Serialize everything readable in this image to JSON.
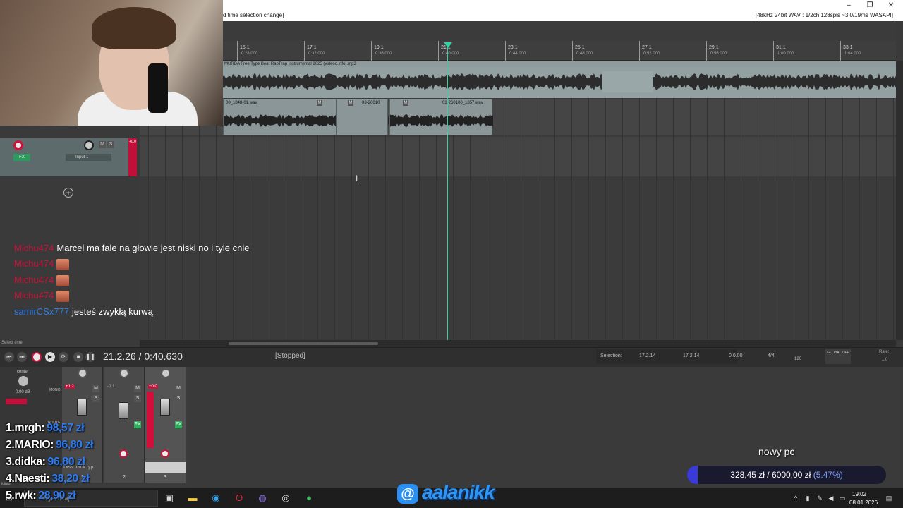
{
  "window": {
    "title_left": "d time selection change]",
    "title_right": "[48kHz 24bit WAV : 1/2ch 128spls ~3.0/19ms WASAPI]",
    "minimize": "–",
    "maximize": "❐",
    "close": "✕"
  },
  "ruler": {
    "ticks": [
      {
        "label": "15.1",
        "time": "0:28.000"
      },
      {
        "label": "17.1",
        "time": "0:32.000"
      },
      {
        "label": "19.1",
        "time": "0:36.000"
      },
      {
        "label": "21.1",
        "time": "0:40.000"
      },
      {
        "label": "23.1",
        "time": "0:44.000"
      },
      {
        "label": "25.1",
        "time": "0:48.000"
      },
      {
        "label": "27.1",
        "time": "0:52.000"
      },
      {
        "label": "29.1",
        "time": "0:56.000"
      },
      {
        "label": "31.1",
        "time": "1:00.000"
      },
      {
        "label": "33.1",
        "time": "1:04.000"
      }
    ]
  },
  "tracks": {
    "beat_item": "MURDA Free Type Beat RapTrap Instrumental 2025 (videoo.info).mp3",
    "clips": [
      {
        "name": "00_1848-01.wav"
      },
      {
        "name": "03-26010"
      },
      {
        "name": "03-260100_1857.wav"
      }
    ],
    "track_input": "Input 1",
    "meter_peak": "+0.0",
    "m_label": "M",
    "s_label": "S",
    "fx_label": "FX",
    "add_track": "+"
  },
  "chat": [
    {
      "user": "Michu474",
      "message": "Marcel ma fale na głowie jest niski no i tyle cnie",
      "emote": false,
      "color": "red"
    },
    {
      "user": "Michu474",
      "message": "",
      "emote": true,
      "color": "red"
    },
    {
      "user": "Michu474",
      "message": "",
      "emote": true,
      "color": "red"
    },
    {
      "user": "Michu474",
      "message": "",
      "emote": true,
      "color": "red"
    },
    {
      "user": "samirCSx777",
      "message": "jesteś zwykłą kurwą",
      "emote": false,
      "color": "blue"
    }
  ],
  "transport": {
    "select_label": "Select time",
    "time": "21.2.26 / 0:40.630",
    "status": "[Stopped]",
    "selection_label": "Selection:",
    "sel_start": "17.2.14",
    "sel_end": "17.2.14",
    "sel_length": "0.0.00",
    "time_sig": "4/4",
    "tempo": "120",
    "global_label": "GLOBAL OFF",
    "rate_label": "Rate:",
    "rate_value": "1.0"
  },
  "mixer": {
    "master_pan": "center",
    "master_db": "0.00 dB",
    "master_label": "Mixer",
    "strip1_peak": "+1.2",
    "strip2_peak": "-0.1",
    "strip3_peak": "+0.0",
    "mono_label": "MONO",
    "route_label": "ROUTE",
    "strip_nums": [
      "1",
      "2",
      "3"
    ],
    "track_name": "Diss track ryp."
  },
  "leaderboard": [
    {
      "rank": "1.",
      "name": "mrgh:",
      "amount": "98,57 zł"
    },
    {
      "rank": "2.",
      "name": "MARIO:",
      "amount": "96,80 zł"
    },
    {
      "rank": "3.",
      "name": "didka:",
      "amount": "96,80 zł"
    },
    {
      "rank": "4.",
      "name": "Naesti:",
      "amount": "38,20 zł"
    },
    {
      "rank": "5.",
      "name": "rwk:",
      "amount": "28,90 zł"
    }
  ],
  "goal": {
    "title": "nowy pc",
    "current": "328,45 zł",
    "target": "6000,00 zł",
    "percent_text": "(5.47%)",
    "percent": 5.47
  },
  "social": {
    "icon": "@",
    "handle": "aalanikk"
  },
  "taskbar": {
    "search_placeholder": "Wyszukaj",
    "time": "19:02",
    "date": "08.01.2026"
  }
}
